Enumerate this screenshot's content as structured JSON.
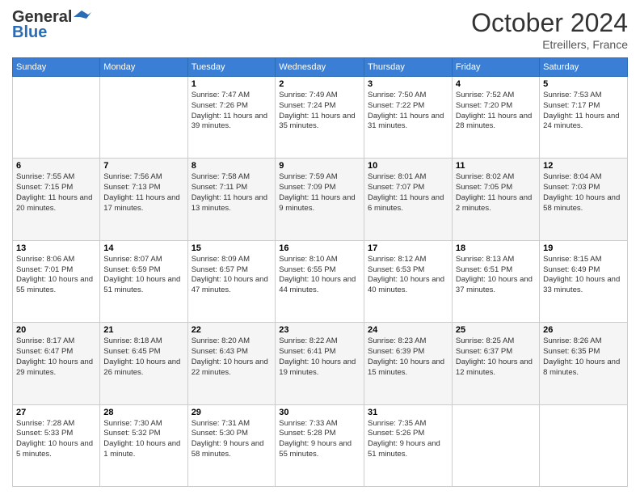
{
  "header": {
    "logo_general": "General",
    "logo_blue": "Blue",
    "month": "October 2024",
    "location": "Etreillers, France"
  },
  "weekdays": [
    "Sunday",
    "Monday",
    "Tuesday",
    "Wednesday",
    "Thursday",
    "Friday",
    "Saturday"
  ],
  "weeks": [
    [
      {
        "day": "",
        "sunrise": "",
        "sunset": "",
        "daylight": ""
      },
      {
        "day": "",
        "sunrise": "",
        "sunset": "",
        "daylight": ""
      },
      {
        "day": "1",
        "sunrise": "Sunrise: 7:47 AM",
        "sunset": "Sunset: 7:26 PM",
        "daylight": "Daylight: 11 hours and 39 minutes."
      },
      {
        "day": "2",
        "sunrise": "Sunrise: 7:49 AM",
        "sunset": "Sunset: 7:24 PM",
        "daylight": "Daylight: 11 hours and 35 minutes."
      },
      {
        "day": "3",
        "sunrise": "Sunrise: 7:50 AM",
        "sunset": "Sunset: 7:22 PM",
        "daylight": "Daylight: 11 hours and 31 minutes."
      },
      {
        "day": "4",
        "sunrise": "Sunrise: 7:52 AM",
        "sunset": "Sunset: 7:20 PM",
        "daylight": "Daylight: 11 hours and 28 minutes."
      },
      {
        "day": "5",
        "sunrise": "Sunrise: 7:53 AM",
        "sunset": "Sunset: 7:17 PM",
        "daylight": "Daylight: 11 hours and 24 minutes."
      }
    ],
    [
      {
        "day": "6",
        "sunrise": "Sunrise: 7:55 AM",
        "sunset": "Sunset: 7:15 PM",
        "daylight": "Daylight: 11 hours and 20 minutes."
      },
      {
        "day": "7",
        "sunrise": "Sunrise: 7:56 AM",
        "sunset": "Sunset: 7:13 PM",
        "daylight": "Daylight: 11 hours and 17 minutes."
      },
      {
        "day": "8",
        "sunrise": "Sunrise: 7:58 AM",
        "sunset": "Sunset: 7:11 PM",
        "daylight": "Daylight: 11 hours and 13 minutes."
      },
      {
        "day": "9",
        "sunrise": "Sunrise: 7:59 AM",
        "sunset": "Sunset: 7:09 PM",
        "daylight": "Daylight: 11 hours and 9 minutes."
      },
      {
        "day": "10",
        "sunrise": "Sunrise: 8:01 AM",
        "sunset": "Sunset: 7:07 PM",
        "daylight": "Daylight: 11 hours and 6 minutes."
      },
      {
        "day": "11",
        "sunrise": "Sunrise: 8:02 AM",
        "sunset": "Sunset: 7:05 PM",
        "daylight": "Daylight: 11 hours and 2 minutes."
      },
      {
        "day": "12",
        "sunrise": "Sunrise: 8:04 AM",
        "sunset": "Sunset: 7:03 PM",
        "daylight": "Daylight: 10 hours and 58 minutes."
      }
    ],
    [
      {
        "day": "13",
        "sunrise": "Sunrise: 8:06 AM",
        "sunset": "Sunset: 7:01 PM",
        "daylight": "Daylight: 10 hours and 55 minutes."
      },
      {
        "day": "14",
        "sunrise": "Sunrise: 8:07 AM",
        "sunset": "Sunset: 6:59 PM",
        "daylight": "Daylight: 10 hours and 51 minutes."
      },
      {
        "day": "15",
        "sunrise": "Sunrise: 8:09 AM",
        "sunset": "Sunset: 6:57 PM",
        "daylight": "Daylight: 10 hours and 47 minutes."
      },
      {
        "day": "16",
        "sunrise": "Sunrise: 8:10 AM",
        "sunset": "Sunset: 6:55 PM",
        "daylight": "Daylight: 10 hours and 44 minutes."
      },
      {
        "day": "17",
        "sunrise": "Sunrise: 8:12 AM",
        "sunset": "Sunset: 6:53 PM",
        "daylight": "Daylight: 10 hours and 40 minutes."
      },
      {
        "day": "18",
        "sunrise": "Sunrise: 8:13 AM",
        "sunset": "Sunset: 6:51 PM",
        "daylight": "Daylight: 10 hours and 37 minutes."
      },
      {
        "day": "19",
        "sunrise": "Sunrise: 8:15 AM",
        "sunset": "Sunset: 6:49 PM",
        "daylight": "Daylight: 10 hours and 33 minutes."
      }
    ],
    [
      {
        "day": "20",
        "sunrise": "Sunrise: 8:17 AM",
        "sunset": "Sunset: 6:47 PM",
        "daylight": "Daylight: 10 hours and 29 minutes."
      },
      {
        "day": "21",
        "sunrise": "Sunrise: 8:18 AM",
        "sunset": "Sunset: 6:45 PM",
        "daylight": "Daylight: 10 hours and 26 minutes."
      },
      {
        "day": "22",
        "sunrise": "Sunrise: 8:20 AM",
        "sunset": "Sunset: 6:43 PM",
        "daylight": "Daylight: 10 hours and 22 minutes."
      },
      {
        "day": "23",
        "sunrise": "Sunrise: 8:22 AM",
        "sunset": "Sunset: 6:41 PM",
        "daylight": "Daylight: 10 hours and 19 minutes."
      },
      {
        "day": "24",
        "sunrise": "Sunrise: 8:23 AM",
        "sunset": "Sunset: 6:39 PM",
        "daylight": "Daylight: 10 hours and 15 minutes."
      },
      {
        "day": "25",
        "sunrise": "Sunrise: 8:25 AM",
        "sunset": "Sunset: 6:37 PM",
        "daylight": "Daylight: 10 hours and 12 minutes."
      },
      {
        "day": "26",
        "sunrise": "Sunrise: 8:26 AM",
        "sunset": "Sunset: 6:35 PM",
        "daylight": "Daylight: 10 hours and 8 minutes."
      }
    ],
    [
      {
        "day": "27",
        "sunrise": "Sunrise: 7:28 AM",
        "sunset": "Sunset: 5:33 PM",
        "daylight": "Daylight: 10 hours and 5 minutes."
      },
      {
        "day": "28",
        "sunrise": "Sunrise: 7:30 AM",
        "sunset": "Sunset: 5:32 PM",
        "daylight": "Daylight: 10 hours and 1 minute."
      },
      {
        "day": "29",
        "sunrise": "Sunrise: 7:31 AM",
        "sunset": "Sunset: 5:30 PM",
        "daylight": "Daylight: 9 hours and 58 minutes."
      },
      {
        "day": "30",
        "sunrise": "Sunrise: 7:33 AM",
        "sunset": "Sunset: 5:28 PM",
        "daylight": "Daylight: 9 hours and 55 minutes."
      },
      {
        "day": "31",
        "sunrise": "Sunrise: 7:35 AM",
        "sunset": "Sunset: 5:26 PM",
        "daylight": "Daylight: 9 hours and 51 minutes."
      },
      {
        "day": "",
        "sunrise": "",
        "sunset": "",
        "daylight": ""
      },
      {
        "day": "",
        "sunrise": "",
        "sunset": "",
        "daylight": ""
      }
    ]
  ]
}
